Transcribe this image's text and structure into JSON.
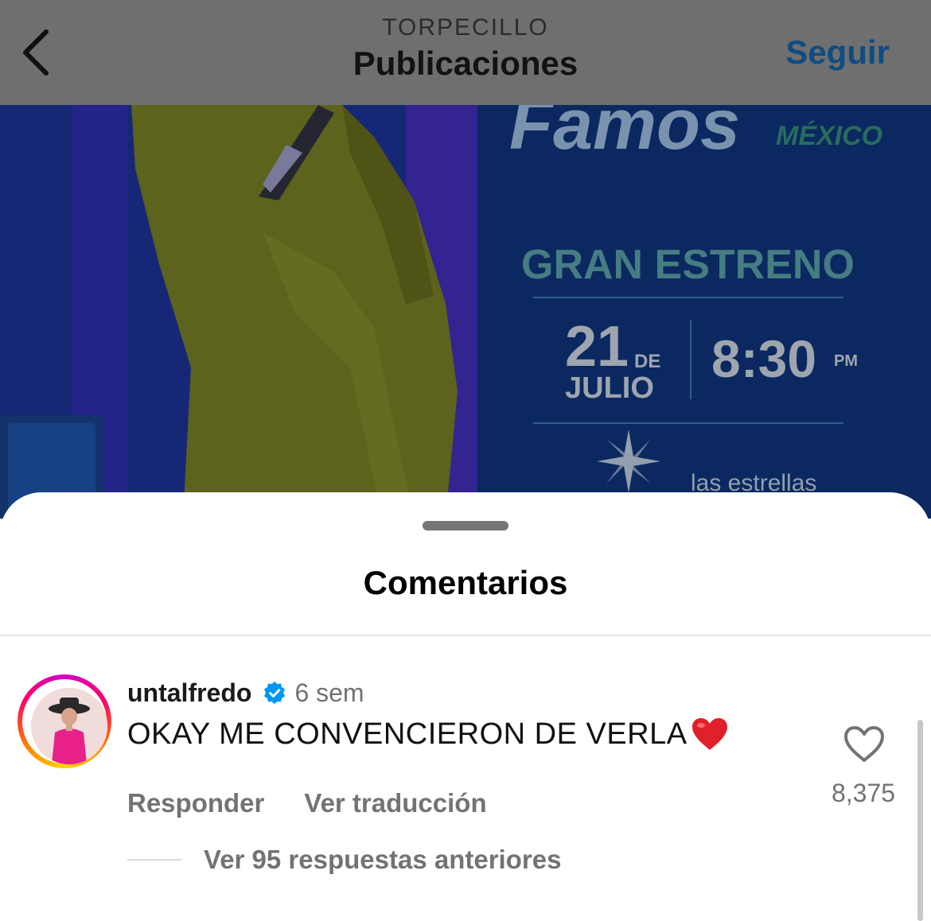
{
  "nav": {
    "account": "TORPECILLO",
    "title": "Publicaciones",
    "follow_label": "Seguir"
  },
  "post_image": {
    "brand_partial": "Famos",
    "country": "MÉXICO",
    "headline": "GRAN ESTRENO",
    "date_day": "21",
    "date_de": "DE",
    "date_month": "JULIO",
    "time": "8:30",
    "time_suffix": "PM",
    "network": "las estrellas"
  },
  "sheet": {
    "title": "Comentarios"
  },
  "comment": {
    "username": "untalfredo",
    "time_ago": "6 sem",
    "text": "OKAY ME CONVENCIERON DE VERLA",
    "reply_label": "Responder",
    "translate_label": "Ver traducción",
    "likes": "8,375"
  },
  "replies": {
    "label": "Ver 95 respuestas anteriores"
  },
  "colors": {
    "nav_bg": "#6f6f6f",
    "follow": "#0f4c82",
    "poster_blue": "#0b2a63",
    "suit_green": "#6a7022",
    "headline_teal": "#4f8f94",
    "verified": "#0095f6",
    "heart_emoji": "#e0202a"
  }
}
